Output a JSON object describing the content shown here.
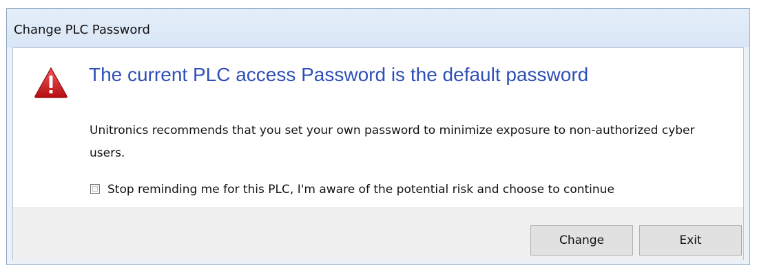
{
  "window": {
    "title": "Change PLC Password"
  },
  "dialog": {
    "icon": "warning-triangle-icon",
    "heading": "The current PLC access Password is the default password",
    "message": "Unitronics recommends that you set your own password to minimize exposure to non-authorized cyber users.",
    "remember_checkbox": {
      "label": "Stop reminding me for this PLC, I'm aware of the potential risk and choose to continue",
      "checked": false
    }
  },
  "buttons": {
    "change_label": "Change",
    "exit_label": "Exit"
  },
  "colors": {
    "heading": "#2e4fb8",
    "warning_red": "#d3141b"
  }
}
